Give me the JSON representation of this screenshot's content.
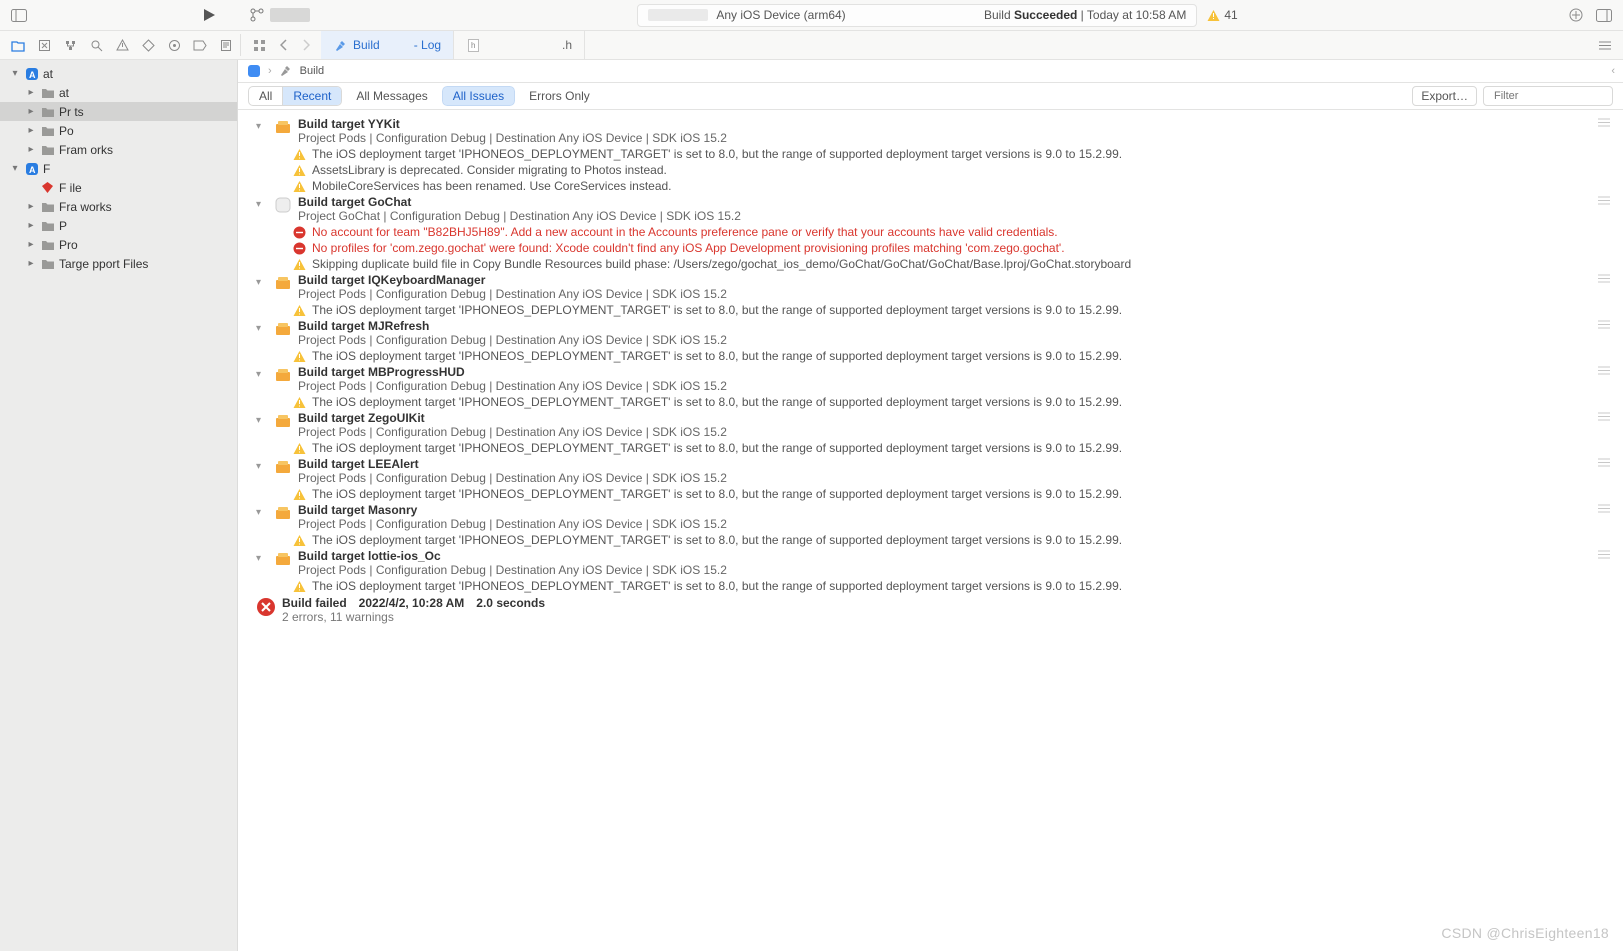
{
  "top": {
    "device": "Any iOS Device (arm64)",
    "build_status_prefix": "Build ",
    "build_status_word": "Succeeded",
    "build_status_time": " | Today at 10:58 AM",
    "warn_count": "41"
  },
  "tabs": {
    "build": "Build",
    "log_suffix": " - Log",
    "header_h": ".h"
  },
  "breadcrumb": {
    "build": "Build"
  },
  "filter": {
    "all": "All",
    "recent": "Recent",
    "all_messages": "All Messages",
    "all_issues": "All Issues",
    "errors_only": "Errors Only",
    "export": "Export…",
    "filter_placeholder": "Filter"
  },
  "sidebar": {
    "items": [
      {
        "indent": 0,
        "disc": "▾",
        "icon": "app",
        "label": "  at"
      },
      {
        "indent": 1,
        "disc": "▸",
        "icon": "folder",
        "label": "    at"
      },
      {
        "indent": 1,
        "disc": "▸",
        "icon": "folder",
        "label": "Pr    ts",
        "selected": true
      },
      {
        "indent": 1,
        "disc": "▸",
        "icon": "folder",
        "label": "Po  "
      },
      {
        "indent": 1,
        "disc": "▸",
        "icon": "folder",
        "label": "Fram   orks"
      },
      {
        "indent": 0,
        "disc": "▾",
        "icon": "app",
        "label": "F   "
      },
      {
        "indent": 1,
        "disc": "",
        "icon": "ruby",
        "label": "F   ile"
      },
      {
        "indent": 1,
        "disc": "▸",
        "icon": "folder",
        "label": "Fra  works"
      },
      {
        "indent": 1,
        "disc": "▸",
        "icon": "folder",
        "label": "P   "
      },
      {
        "indent": 1,
        "disc": "▸",
        "icon": "folder",
        "label": "Pro   "
      },
      {
        "indent": 1,
        "disc": "▸",
        "icon": "folder",
        "label": "Targe    pport Files"
      }
    ]
  },
  "targets": [
    {
      "name": "Build target YYKit",
      "sub": "Project Pods | Configuration Debug | Destination Any iOS Device | SDK iOS 15.2",
      "msgs": [
        {
          "t": "warn",
          "txt": "The iOS deployment target 'IPHONEOS_DEPLOYMENT_TARGET' is set to 8.0, but the range of supported deployment target versions is 9.0 to 15.2.99."
        },
        {
          "t": "warn",
          "txt": "AssetsLibrary is deprecated. Consider migrating to Photos instead."
        },
        {
          "t": "warn",
          "txt": "MobileCoreServices has been renamed. Use CoreServices instead."
        }
      ]
    },
    {
      "name": "Build target GoChat",
      "sub": "Project GoChat | Configuration Debug | Destination Any iOS Device | SDK iOS 15.2",
      "icon": "app",
      "msgs": [
        {
          "t": "err",
          "txt": "No account for team \"B82BHJ5H89\". Add a new account in the Accounts preference pane or verify that your accounts have valid credentials."
        },
        {
          "t": "err",
          "txt": "No profiles for 'com.zego.gochat' were found: Xcode couldn't find any iOS App Development provisioning profiles matching 'com.zego.gochat'."
        },
        {
          "t": "warn",
          "txt": "Skipping duplicate build file in Copy Bundle Resources build phase: /Users/zego/gochat_ios_demo/GoChat/GoChat/GoChat/Base.lproj/GoChat.storyboard"
        }
      ]
    },
    {
      "name": "Build target IQKeyboardManager",
      "sub": "Project Pods | Configuration Debug | Destination Any iOS Device | SDK iOS 15.2",
      "msgs": [
        {
          "t": "warn",
          "txt": "The iOS deployment target 'IPHONEOS_DEPLOYMENT_TARGET' is set to 8.0, but the range of supported deployment target versions is 9.0 to 15.2.99."
        }
      ]
    },
    {
      "name": "Build target MJRefresh",
      "sub": "Project Pods | Configuration Debug | Destination Any iOS Device | SDK iOS 15.2",
      "msgs": [
        {
          "t": "warn",
          "txt": "The iOS deployment target 'IPHONEOS_DEPLOYMENT_TARGET' is set to 8.0, but the range of supported deployment target versions is 9.0 to 15.2.99."
        }
      ]
    },
    {
      "name": "Build target MBProgressHUD",
      "sub": "Project Pods | Configuration Debug | Destination Any iOS Device | SDK iOS 15.2",
      "msgs": [
        {
          "t": "warn",
          "txt": "The iOS deployment target 'IPHONEOS_DEPLOYMENT_TARGET' is set to 8.0, but the range of supported deployment target versions is 9.0 to 15.2.99."
        }
      ]
    },
    {
      "name": "Build target ZegoUIKit",
      "sub": "Project Pods | Configuration Debug | Destination Any iOS Device | SDK iOS 15.2",
      "msgs": [
        {
          "t": "warn",
          "txt": "The iOS deployment target 'IPHONEOS_DEPLOYMENT_TARGET' is set to 8.0, but the range of supported deployment target versions is 9.0 to 15.2.99."
        }
      ]
    },
    {
      "name": "Build target LEEAlert",
      "sub": "Project Pods | Configuration Debug | Destination Any iOS Device | SDK iOS 15.2",
      "msgs": [
        {
          "t": "warn",
          "txt": "The iOS deployment target 'IPHONEOS_DEPLOYMENT_TARGET' is set to 8.0, but the range of supported deployment target versions is 9.0 to 15.2.99."
        }
      ]
    },
    {
      "name": "Build target Masonry",
      "sub": "Project Pods | Configuration Debug | Destination Any iOS Device | SDK iOS 15.2",
      "msgs": [
        {
          "t": "warn",
          "txt": "The iOS deployment target 'IPHONEOS_DEPLOYMENT_TARGET' is set to 8.0, but the range of supported deployment target versions is 9.0 to 15.2.99."
        }
      ]
    },
    {
      "name": "Build target lottie-ios_Oc",
      "sub": "Project Pods | Configuration Debug | Destination Any iOS Device | SDK iOS 15.2",
      "msgs": [
        {
          "t": "warn",
          "txt": "The iOS deployment target 'IPHONEOS_DEPLOYMENT_TARGET' is set to 8.0, but the range of supported deployment target versions is 9.0 to 15.2.99."
        }
      ]
    }
  ],
  "fail": {
    "l1a": "Build failed",
    "l1b": "2022/4/2, 10:28 AM",
    "l1c": "2.0 seconds",
    "l2": "2 errors, 11 warnings"
  },
  "watermark": "CSDN @ChrisEighteen18"
}
